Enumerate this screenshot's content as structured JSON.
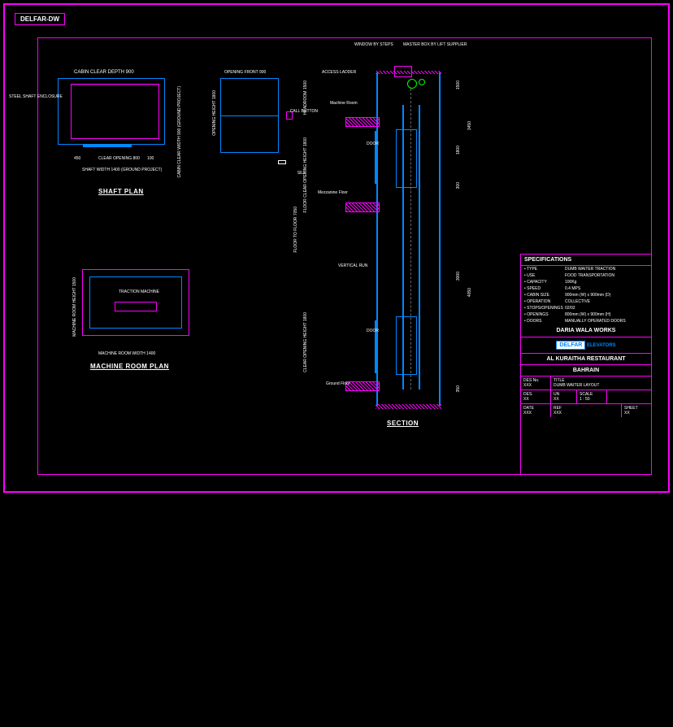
{
  "logo": "DELFAR-DW",
  "titles": {
    "shaft_plan": "SHAFT PLAN",
    "machine_room": "MACHINE ROOM PLAN",
    "section": "SECTION"
  },
  "labels": {
    "steel_shaft_enclosure": "STEEL SHAFT ENCLOSURE",
    "cabin_clear_depth": "CABIN CLEAR DEPTH 900",
    "cabin_clear_width": "CABIN CLEAR WIDTH 900 (GROUND PROJECT)",
    "clear_opening": "CLEAR OPENING 800",
    "shaft_width": "SHAFT WIDTH 1400 (GROUND PROJECT)",
    "dim_450": "450",
    "dim_100": "100",
    "opening_front": "OPENING FRONT 900",
    "opening_height": "OPENING HEIGHT 1800",
    "call_button": "CALL BUTTON",
    "sill": "SILL",
    "traction_machine": "TRACTION MACHINE",
    "machine_room_height": "MACHINE ROOM HEIGHT 1500",
    "machine_room_width": "MACHINE ROOM WIDTH 1400",
    "window_by_steps": "WINDOW BY STEPS",
    "master_box": "MASTER BOX BY LIFT SUPPLIER",
    "access_ladder": "ACCESS LADDER",
    "machine_room": "Machine Room",
    "mezzanine_floor": "Mezzanine Floor",
    "vertical_run": "VERTICAL RUN",
    "door": "DOOR",
    "ground_floor": "Ground Floor",
    "floor_to_floor": "FLOOR TO FLOOR  7050",
    "headroom": "HEADROOM 1500",
    "floor_opening": "FLOOR CLEAR OPENING HEIGHT 1800",
    "clear_opening_height": "CLEAR OPENING HEIGHT 1800",
    "pit": "350",
    "d_3000": "3000",
    "d_300": "300",
    "d_4050": "4050",
    "d_3450": "3450",
    "d_1800": "1800",
    "d_1500": "1500"
  },
  "specs": {
    "header": "SPECIFICATIONS",
    "rows": [
      {
        "k": "TYPE",
        "v": "DUMB WAITER TRACTION"
      },
      {
        "k": "USE",
        "v": "FOOD TRANSPORTATION"
      },
      {
        "k": "CAPACITY",
        "v": "100Kg"
      },
      {
        "k": "SPEED",
        "v": "0.4 MPS"
      },
      {
        "k": "CABIN SIZE",
        "v": "900mm (W) x 900mm (D)"
      },
      {
        "k": "OPERATION",
        "v": "COLLECTIVE"
      },
      {
        "k": "STOPS/OPENINGS",
        "v": "02/02"
      },
      {
        "k": "OPENINGS",
        "v": "800mm (W) x 900mm (H)"
      },
      {
        "k": "DOORS",
        "v": "MANUALLY OPERATED DOORS"
      }
    ]
  },
  "titleblock": {
    "company": "DARIA WALA WORKS",
    "delfar_logo": "DELFAR",
    "delfar_sub": "ELEVATORS",
    "project1": "AL KURAITHA RESTAURANT",
    "project2": "BAHRAIN",
    "desno_k": "DES No.",
    "desno_v": "XXX",
    "title_k": "TITLE",
    "title_v": "DUMB WAITER LAYOUT",
    "des_k": "DES.",
    "des_v": "XX",
    "un_k": "UN",
    "un_v": "XX",
    "scale_k": "SCALE",
    "scale_v": "1 : 50",
    "date_k": "DATE",
    "date_v": "XXX",
    "ref_k": "REF",
    "ref_v": "XXX",
    "sheet_k": "SHEET",
    "sheet_v": "XX"
  }
}
